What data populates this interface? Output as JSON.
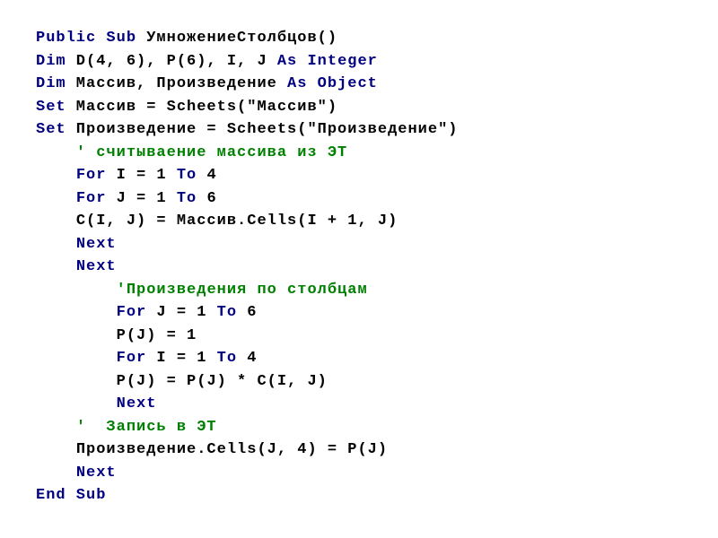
{
  "code": {
    "lines": [
      {
        "indent": 0,
        "tokens": [
          {
            "c": "kw",
            "t": "Public Sub"
          },
          {
            "c": "txt",
            "t": " УмножениеСтолбцов()"
          }
        ]
      },
      {
        "indent": 0,
        "tokens": [
          {
            "c": "kw",
            "t": "Dim"
          },
          {
            "c": "txt",
            "t": " D(4, 6), P(6), I, J "
          },
          {
            "c": "kw",
            "t": "As Integer"
          }
        ]
      },
      {
        "indent": 0,
        "tokens": [
          {
            "c": "kw",
            "t": "Dim"
          },
          {
            "c": "txt",
            "t": " Массив, Произведение "
          },
          {
            "c": "kw",
            "t": "As Object"
          }
        ]
      },
      {
        "indent": 0,
        "tokens": [
          {
            "c": "kw",
            "t": "Set"
          },
          {
            "c": "txt",
            "t": " Массив = Scheets(\"Массив\")"
          }
        ]
      },
      {
        "indent": 0,
        "tokens": [
          {
            "c": "kw",
            "t": "Set"
          },
          {
            "c": "txt",
            "t": " Произведение = Scheets(\"Произведение\")"
          }
        ]
      },
      {
        "indent": 1,
        "tokens": [
          {
            "c": "comment",
            "t": "' считываение массива из ЭТ"
          }
        ]
      },
      {
        "indent": 1,
        "tokens": [
          {
            "c": "kw",
            "t": "For"
          },
          {
            "c": "txt",
            "t": " I = 1 "
          },
          {
            "c": "kw",
            "t": "To"
          },
          {
            "c": "txt",
            "t": " 4"
          }
        ]
      },
      {
        "indent": 1,
        "tokens": [
          {
            "c": "kw",
            "t": "For"
          },
          {
            "c": "txt",
            "t": " J = 1 "
          },
          {
            "c": "kw",
            "t": "To"
          },
          {
            "c": "txt",
            "t": " 6"
          }
        ]
      },
      {
        "indent": 1,
        "tokens": [
          {
            "c": "txt",
            "t": "C(I, J) = Массив.Cells(I + 1, J)"
          }
        ]
      },
      {
        "indent": 1,
        "tokens": [
          {
            "c": "kw",
            "t": "Next"
          }
        ]
      },
      {
        "indent": 1,
        "tokens": [
          {
            "c": "kw",
            "t": "Next"
          }
        ]
      },
      {
        "indent": 2,
        "tokens": [
          {
            "c": "comment",
            "t": "'Произведения по столбцам"
          }
        ]
      },
      {
        "indent": 2,
        "tokens": [
          {
            "c": "kw",
            "t": "For"
          },
          {
            "c": "txt",
            "t": " J = 1 "
          },
          {
            "c": "kw",
            "t": "To"
          },
          {
            "c": "txt",
            "t": " 6"
          }
        ]
      },
      {
        "indent": 2,
        "tokens": [
          {
            "c": "txt",
            "t": "P(J) = 1"
          }
        ]
      },
      {
        "indent": 2,
        "tokens": [
          {
            "c": "kw",
            "t": "For"
          },
          {
            "c": "txt",
            "t": " I = 1 "
          },
          {
            "c": "kw",
            "t": "To"
          },
          {
            "c": "txt",
            "t": " 4"
          }
        ]
      },
      {
        "indent": 2,
        "tokens": [
          {
            "c": "txt",
            "t": "P(J) = P(J) * C(I, J)"
          }
        ]
      },
      {
        "indent": 2,
        "tokens": [
          {
            "c": "kw",
            "t": "Next"
          }
        ]
      },
      {
        "indent": 1,
        "tokens": [
          {
            "c": "comment",
            "t": "'  Запись в ЭТ"
          }
        ]
      },
      {
        "indent": 1,
        "tokens": [
          {
            "c": "txt",
            "t": "Произведение.Cells(J, 4) = P(J)"
          }
        ]
      },
      {
        "indent": 1,
        "tokens": [
          {
            "c": "kw",
            "t": "Next"
          }
        ]
      },
      {
        "indent": 0,
        "tokens": [
          {
            "c": "kw",
            "t": "End Sub"
          }
        ]
      }
    ]
  },
  "indent_unit": "    "
}
